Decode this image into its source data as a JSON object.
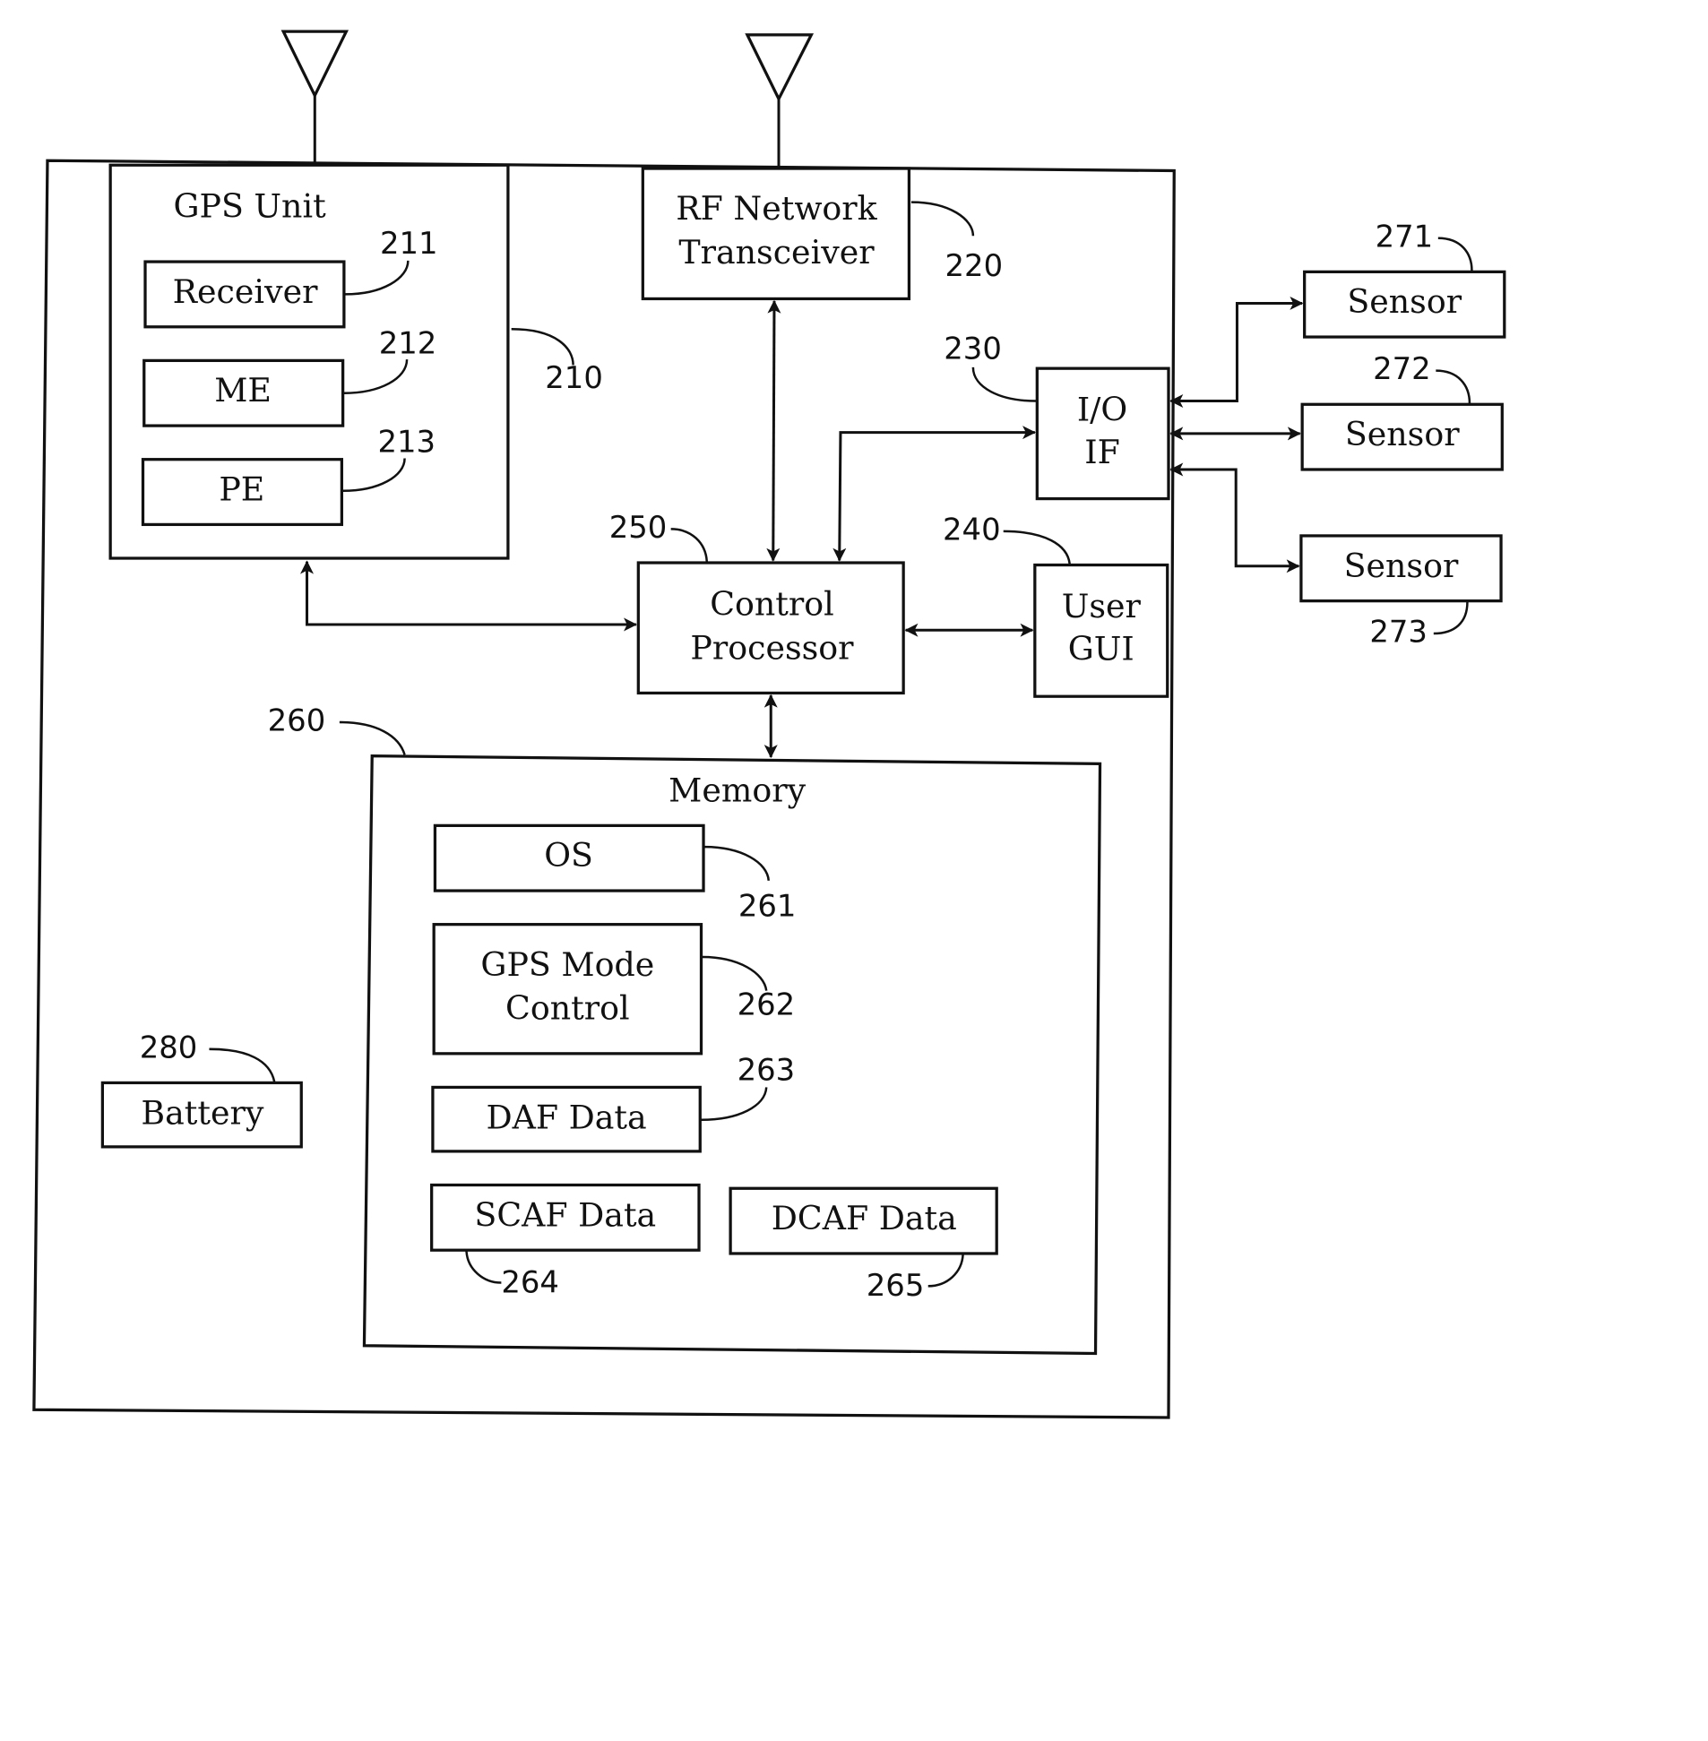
{
  "diagram": {
    "type": "block-diagram",
    "device": {
      "ref": "",
      "blocks": {
        "gps_unit": {
          "label": "GPS Unit",
          "ref": "210",
          "children": [
            {
              "label": "Receiver",
              "ref": "211"
            },
            {
              "label": "ME",
              "ref": "212"
            },
            {
              "label": "PE",
              "ref": "213"
            }
          ]
        },
        "rf": {
          "label_line1": "RF Network",
          "label_line2": "Transceiver",
          "ref": "220"
        },
        "io": {
          "label_line1": "I/O",
          "label_line2": "IF",
          "ref": "230"
        },
        "gui": {
          "label_line1": "User",
          "label_line2": "GUI",
          "ref": "240"
        },
        "cpu": {
          "label_line1": "Control",
          "label_line2": "Processor",
          "ref": "250"
        },
        "memory": {
          "label": "Memory",
          "ref": "260",
          "children": {
            "os": {
              "label": "OS",
              "ref": "261"
            },
            "gps_mode": {
              "label_line1": "GPS Mode",
              "label_line2": "Control",
              "ref": "262"
            },
            "daf": {
              "label": "DAF Data",
              "ref": "263"
            },
            "scaf": {
              "label": "SCAF Data",
              "ref": "264"
            },
            "dcaf": {
              "label": "DCAF Data",
              "ref": "265"
            }
          }
        },
        "battery": {
          "label": "Battery",
          "ref": "280"
        }
      }
    },
    "sensors": [
      {
        "label": "Sensor",
        "ref": "271"
      },
      {
        "label": "Sensor",
        "ref": "272"
      },
      {
        "label": "Sensor",
        "ref": "273"
      }
    ],
    "connections": [
      "GPS Unit <-> Control Processor",
      "RF Network Transceiver <-> Control Processor",
      "I/O IF <-> Control Processor",
      "Control Processor <-> User GUI",
      "Control Processor <-> Memory",
      "I/O IF <-> Sensor 271",
      "I/O IF <-> Sensor 272",
      "I/O IF <-> Sensor 273"
    ]
  }
}
